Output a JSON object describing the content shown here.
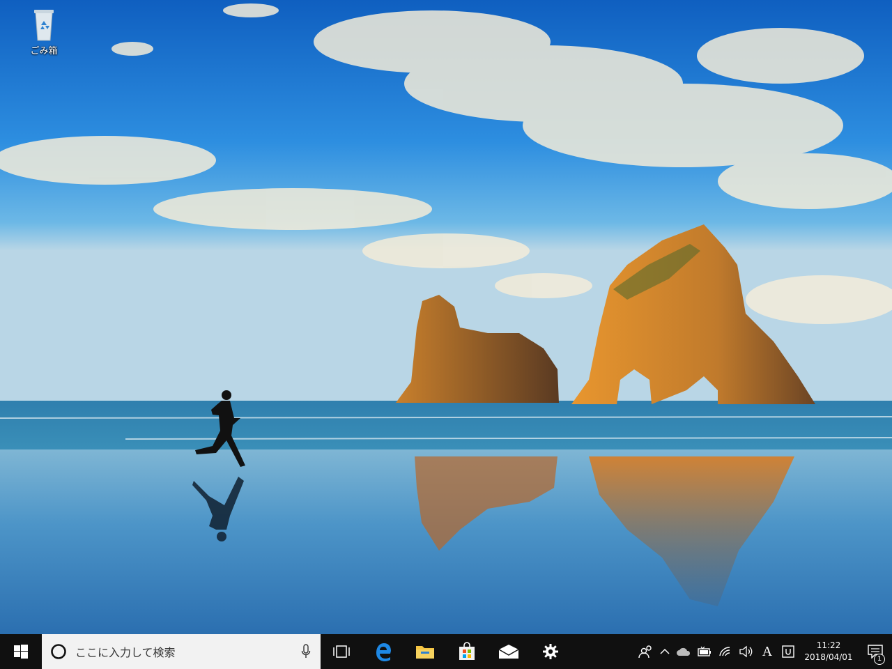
{
  "desktop": {
    "icons": [
      {
        "label": "ごみ箱",
        "icon": "recycle-bin-icon"
      }
    ]
  },
  "taskbar": {
    "start_icon": "windows-logo-icon",
    "search": {
      "placeholder": "ここに入力して検索",
      "cortana_icon": "cortana-circle-icon",
      "mic_icon": "microphone-icon"
    },
    "apps": [
      {
        "name": "task-view",
        "icon": "task-view-icon"
      },
      {
        "name": "edge",
        "icon": "edge-icon"
      },
      {
        "name": "file-explorer",
        "icon": "folder-icon"
      },
      {
        "name": "store",
        "icon": "store-bag-icon"
      },
      {
        "name": "mail",
        "icon": "mail-icon"
      },
      {
        "name": "settings",
        "icon": "gear-icon"
      }
    ],
    "tray": {
      "people_icon": "people-icon",
      "chevron_icon": "chevron-up-icon",
      "onedrive_icon": "cloud-icon",
      "battery_icon": "battery-icon",
      "wifi_icon": "wifi-icon",
      "volume_icon": "volume-icon",
      "ime_label": "A",
      "clock_time": "11:22",
      "clock_date": "2018/04/01",
      "notification_count": "1"
    }
  },
  "colors": {
    "taskbar_bg": "#101010",
    "search_bg": "#f2f2f2",
    "edge_blue": "#1e88e5",
    "folder_yellow": "#f5c542"
  }
}
